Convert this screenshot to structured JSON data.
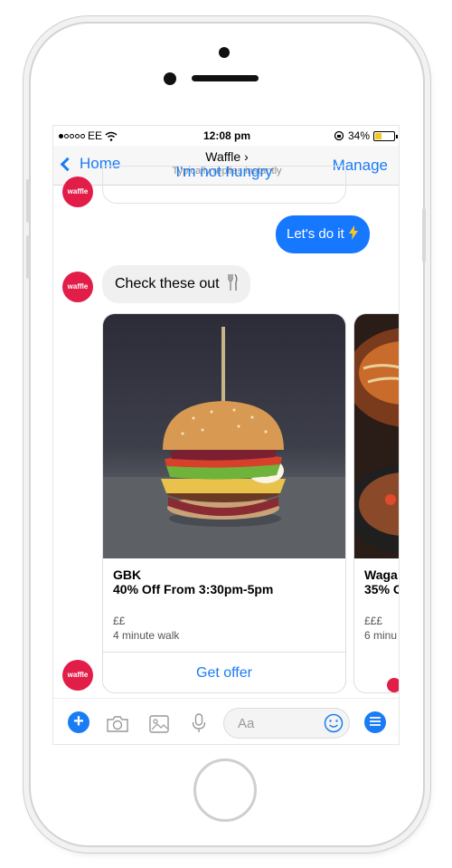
{
  "status_bar": {
    "carrier": "EE",
    "time": "12:08 pm",
    "battery": "34%"
  },
  "nav": {
    "back_label": "Home",
    "title": "Waffle",
    "subtitle": "Typically replies instantly",
    "manage_label": "Manage"
  },
  "avatar_label": "waffle",
  "messages": {
    "quick_reply": "I'm not hungry",
    "user_reply": "Let's do it",
    "bot_text": "Check these out"
  },
  "cards": [
    {
      "title": "GBK",
      "offer": "40% Off From 3:30pm-5pm",
      "price": "££",
      "distance": "4 minute walk",
      "button": "Get offer"
    },
    {
      "title": "Waga",
      "offer": "35% O",
      "price": "£££",
      "distance": "6 minu"
    }
  ],
  "composer": {
    "placeholder": "Aa"
  },
  "colors": {
    "accent": "#1a7cf5",
    "brand": "#e11d48",
    "user_bubble": "#1677ff"
  }
}
